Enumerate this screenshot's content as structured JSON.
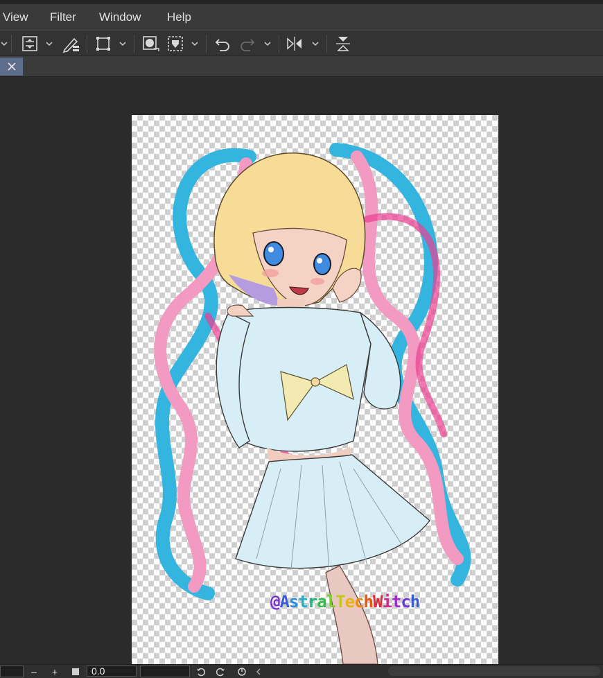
{
  "menu": {
    "items": [
      {
        "label": "View"
      },
      {
        "label": "Filter"
      },
      {
        "label": "Window"
      },
      {
        "label": "Help"
      }
    ]
  },
  "tab": {
    "close_icon": "close-icon"
  },
  "canvas": {
    "signature": [
      "@",
      "A",
      "s",
      "t",
      "r",
      "a",
      "l",
      "T",
      "e",
      "c",
      "h",
      "W",
      "i",
      "t",
      "c",
      "h"
    ],
    "signature_colors": [
      "#7b2fd0",
      "#3a5bd9",
      "#2a8ee0",
      "#1fb0c8",
      "#1db37a",
      "#2fc048",
      "#7ad024",
      "#c4c81a",
      "#e8b410",
      "#f08a12",
      "#e85a14",
      "#e0243a",
      "#d02a8a",
      "#a42ad0",
      "#6a3ad8",
      "#3a5bd9"
    ]
  },
  "statusbar": {
    "zoom_value": "0.0",
    "minus_label": "–",
    "plus_label": "+"
  },
  "colors": {
    "accent_tab": "#5c6e8c",
    "menubar_bg": "#3a3a3a",
    "workspace_bg": "#2b2b2b"
  }
}
